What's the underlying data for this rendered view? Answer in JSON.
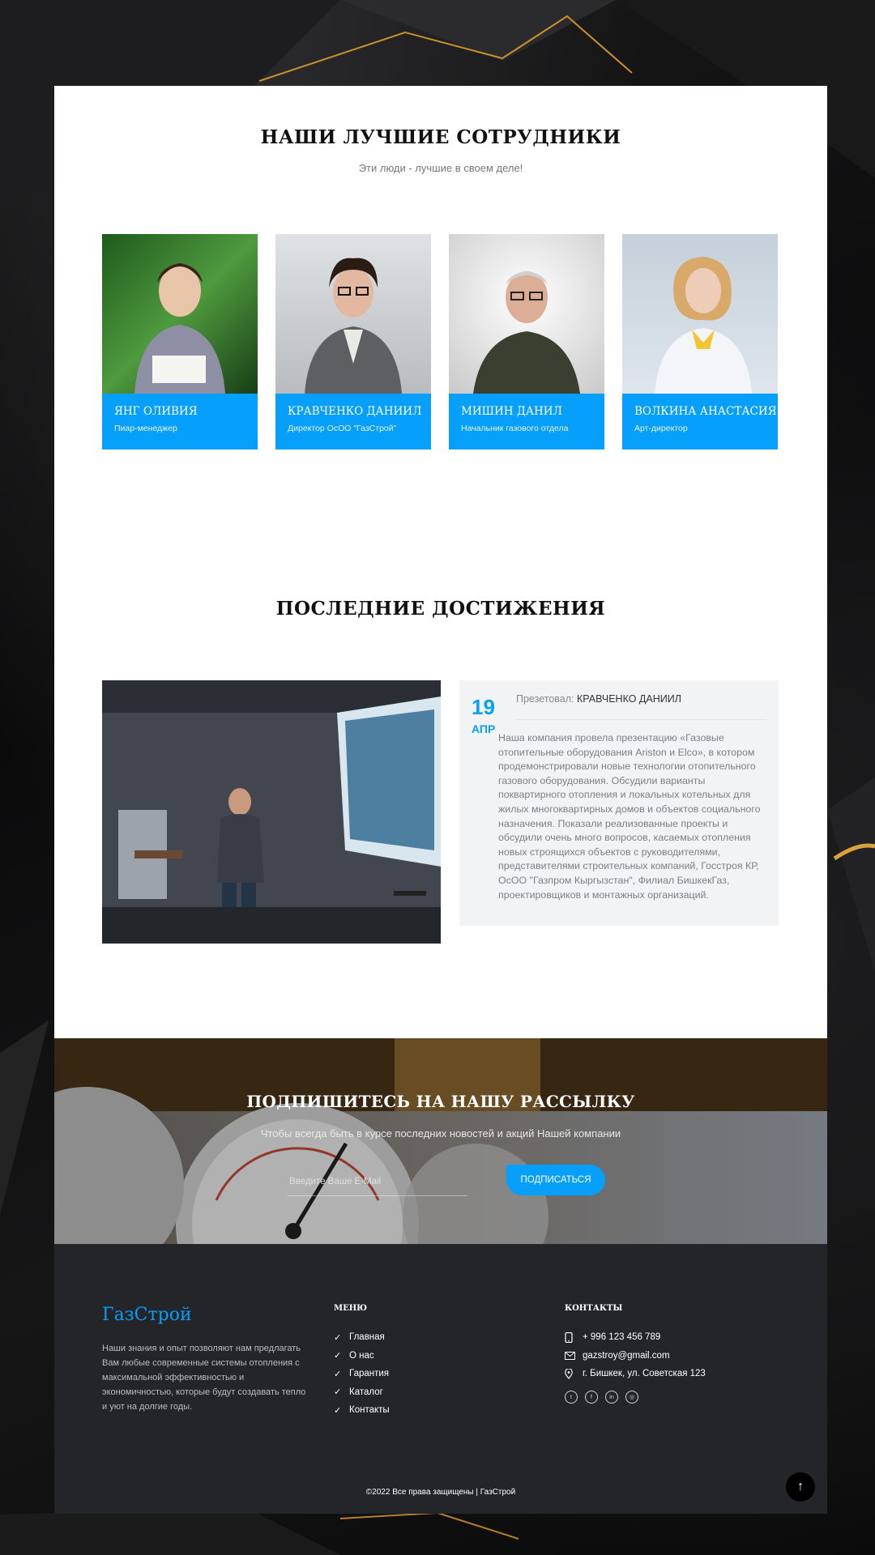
{
  "team": {
    "title": "НАШИ ЛУЧШИЕ СОТРУДНИКИ",
    "subtitle": "Эти люди - лучшие в своем деле!",
    "members": [
      {
        "name": "ЯНГ ОЛИВИЯ",
        "role": "Пиар-менеджер"
      },
      {
        "name": "КРАВЧЕНКО ДАНИИЛ",
        "role": "Директор ОсОО \"ГазСтрой\""
      },
      {
        "name": "МИШИН ДАНИЛ",
        "role": "Начальник газового отдела"
      },
      {
        "name": "ВОЛКИНА АНАСТАСИЯ",
        "role": "Арт-директор"
      }
    ]
  },
  "achievements": {
    "title": "ПОСЛЕДНИЕ ДОСТИЖЕНИЯ",
    "day": "19",
    "month": "АПР",
    "presenter_label": "Презетовал:",
    "presenter_name": "КРАВЧЕНКО ДАНИИЛ",
    "description": "Наша компания провела презентацию «Газовые отопительные оборудования Ariston и Elco», в котором продемонстрировали новые технологии отопительного газового оборудования. Обсудили варианты поквартирного отопления и локальных котельных для жилых многоквартирных домов и объектов социального назначения. Показали реализованные проекты и обсудили очень много вопросов, касаемых отопления новых строящихся объектов с руководителями, представителями строительных компаний, Госстроя КР, ОсОО \"Газпром Кыргызстан\", Филиал БишкекГаз, проектировщиков и монтажных организаций."
  },
  "newsletter": {
    "title": "ПОДПИШИТЕСЬ НА НАШУ РАССЫЛКУ",
    "subtitle": "Чтобы всегда быть в курсе последних новостей и акций Нашей компании",
    "placeholder": "Введите Ваше E-Mail",
    "button": "ПОДПИСАТЬСЯ"
  },
  "footer": {
    "brand": "ГазСтрой",
    "about": "Наши знания и опыт позволяют нам предлагать Вам любые современные системы отопления с максимальной эффективностью и экономичностью, которые будут создавать тепло и уют на долгие годы.",
    "menu_title": "МЕНЮ",
    "menu": [
      "Главная",
      "О нас",
      "Гарантия",
      "Каталог",
      "Контакты"
    ],
    "contacts_title": "КОНТАКТЫ",
    "phone": "+ 996 123 456 789",
    "email": "gazstroy@gmail.com",
    "address": "г. Бишкек, ул. Советская 123",
    "socials": [
      "twitter-icon",
      "facebook-icon",
      "linkedin-icon",
      "dribbble-icon"
    ],
    "copyright": "©2022 Все права защищены | ГазСтрой"
  },
  "colors": {
    "accent": "#069ffc",
    "footer_bg": "#232529"
  }
}
